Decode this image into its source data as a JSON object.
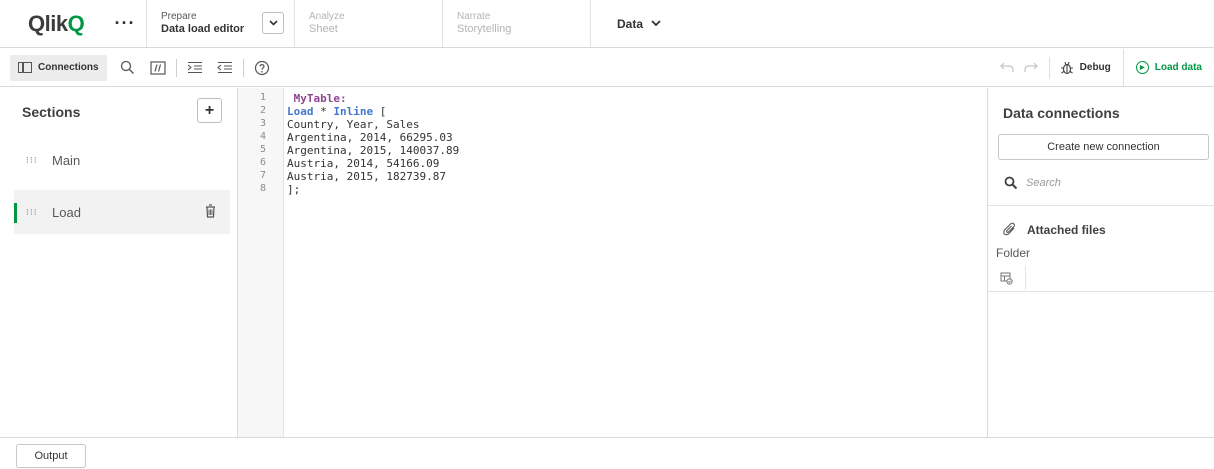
{
  "nav": {
    "logo_text": "Qlik",
    "logo_mark": "Q",
    "more_label": "···",
    "tabs": [
      {
        "title": "Prepare",
        "subtitle": "Data load editor"
      },
      {
        "title": "Analyze",
        "subtitle": "Sheet"
      },
      {
        "title": "Narrate",
        "subtitle": "Storytelling"
      }
    ],
    "dropdown_chevron": "⌄",
    "data_menu_label": "Data"
  },
  "toolbar": {
    "connections_label": "Connections",
    "debug_label": "Debug",
    "load_data_label": "Load data",
    "icons": [
      "search-icon",
      "comment-icon",
      "indent-icon",
      "outdent-icon",
      "help-icon",
      "undo-icon",
      "redo-icon",
      "debug-icon",
      "play-icon"
    ]
  },
  "sections": {
    "title": "Sections",
    "add_label": "+",
    "items": [
      {
        "label": "Main"
      },
      {
        "label": "Load"
      }
    ]
  },
  "editor": {
    "line_numbers": [
      "1",
      "2",
      "3",
      "4",
      "5",
      "6",
      "7",
      "8"
    ],
    "lines": [
      {
        "a": " MyTable:",
        "b": "",
        "c": "",
        "d": ""
      },
      {
        "a": "Load",
        "b": " * ",
        "c": "Inline",
        "d": " ["
      },
      {
        "a": "Country, Year, Sales",
        "b": "",
        "c": "",
        "d": ""
      },
      {
        "a": "Argentina, 2014, 66295.03",
        "b": "",
        "c": "",
        "d": ""
      },
      {
        "a": "Argentina, 2015, 140037.89",
        "b": "",
        "c": "",
        "d": ""
      },
      {
        "a": "Austria, 2014, 54166.09",
        "b": "",
        "c": "",
        "d": ""
      },
      {
        "a": "Austria, 2015, 182739.87",
        "b": "",
        "c": "",
        "d": ""
      },
      {
        "a": "];",
        "b": "",
        "c": "",
        "d": ""
      }
    ]
  },
  "right_panel": {
    "title": "Data connections",
    "create_label": "Create new connection",
    "search_placeholder": "Search",
    "attached_label": "Attached files",
    "folder_label": "Folder"
  },
  "bottom": {
    "output_label": "Output"
  },
  "colors": {
    "accent_green": "#009845",
    "keyword_purple": "#8f4591",
    "keyword_blue": "#4477c9"
  }
}
